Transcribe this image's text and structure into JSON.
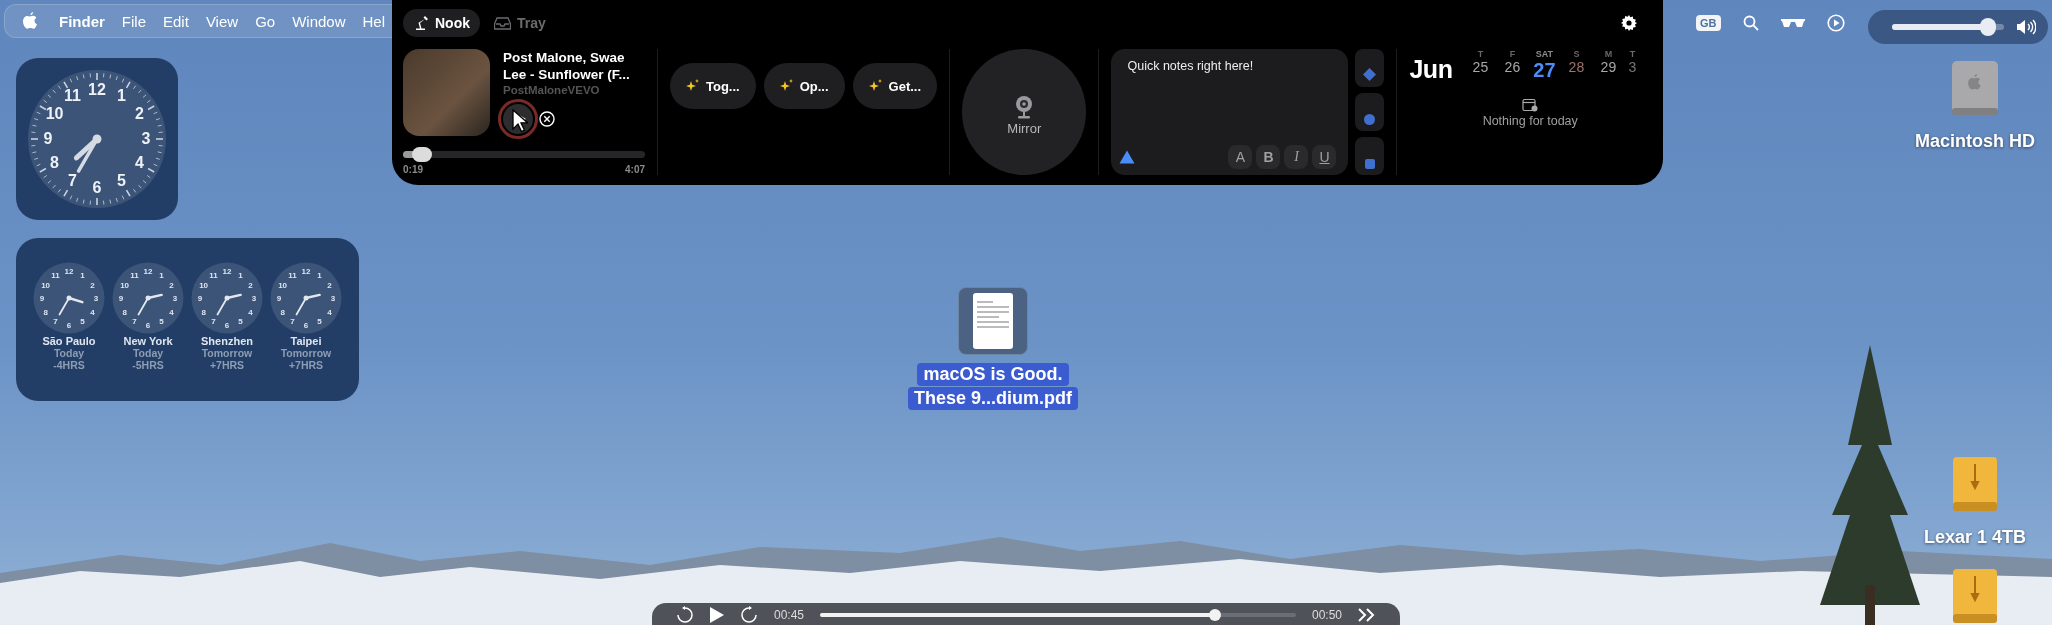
{
  "menu_bar": {
    "app": "Finder",
    "items": [
      "File",
      "Edit",
      "View",
      "Go",
      "Window",
      "Hel"
    ]
  },
  "status": {
    "keyboard": "GB"
  },
  "volume": {
    "level": 0.86
  },
  "clock_widget": {
    "numerals": [
      "11",
      "12",
      "1",
      "10",
      "2",
      "9",
      "3",
      "8",
      "4",
      "7",
      "6",
      "5"
    ]
  },
  "world_clocks": [
    {
      "city": "São Paulo",
      "day": "Today",
      "offset": "-4HRS",
      "numerals": [
        "11",
        "12",
        "1",
        "10",
        "2",
        "9",
        "3",
        "8",
        "4",
        "7",
        "6",
        "5"
      ]
    },
    {
      "city": "New York",
      "day": "Today",
      "offset": "-5HRS",
      "numerals": [
        "11",
        "12",
        "1",
        "10",
        "2",
        "9",
        "3",
        "8",
        "4",
        "7",
        "6",
        "5"
      ]
    },
    {
      "city": "Shenzhen",
      "day": "Tomorrow",
      "offset": "+7HRS",
      "numerals": [
        "11",
        "12",
        "1",
        "10",
        "2",
        "9",
        "3",
        "8",
        "4",
        "7",
        "6",
        "5"
      ]
    },
    {
      "city": "Taipei",
      "day": "Tomorrow",
      "offset": "+7HRS",
      "numerals": [
        "11",
        "12",
        "1",
        "10",
        "2",
        "9",
        "3",
        "8",
        "4",
        "7",
        "6",
        "5"
      ]
    }
  ],
  "nook": {
    "tabs": [
      {
        "label": "Nook",
        "selected": true
      },
      {
        "label": "Tray",
        "selected": false
      }
    ],
    "player": {
      "title": "Post Malone, Swae Lee - Sunflower (F...",
      "artist": "PostMaloneVEVO",
      "playing": false,
      "level": 0.08,
      "elapsed": "0:19",
      "duration": "4:07"
    },
    "shortcuts": [
      "Tog...",
      "Op...",
      "Get..."
    ],
    "mirror": {
      "label": "Mirror"
    },
    "notes": {
      "value": "Quick notes right here!",
      "format_buttons": [
        "A",
        "B",
        "I",
        "U"
      ]
    },
    "calendar": {
      "month": "Jun",
      "days": [
        {
          "weekday": "T",
          "day": "25",
          "selected": false,
          "weekend": false
        },
        {
          "weekday": "F",
          "day": "26",
          "selected": false,
          "weekend": false
        },
        {
          "weekday": "SAT",
          "day": "27",
          "selected": true,
          "weekend": true
        },
        {
          "weekday": "S",
          "day": "28",
          "selected": false,
          "weekend": true
        },
        {
          "weekday": "M",
          "day": "29",
          "selected": false,
          "weekend": false
        },
        {
          "weekday": "T",
          "day": "3",
          "selected": false,
          "weekend": false
        }
      ],
      "empty_text": "Nothing for today"
    }
  },
  "desktop_items": [
    {
      "kind": "disk",
      "lines": [
        "Macintosh HD"
      ],
      "selected": false
    },
    {
      "kind": "document",
      "lines": [
        "macOS is Good.",
        "These 9...dium.pdf"
      ],
      "selected": true
    },
    {
      "kind": "external",
      "lines": [
        "Lexar 1 4TB"
      ],
      "selected": false
    },
    {
      "kind": "external",
      "selected": false
    }
  ],
  "video_bar": {
    "elapsed": "00:45",
    "remaining": "00:50",
    "level": 0.83
  }
}
